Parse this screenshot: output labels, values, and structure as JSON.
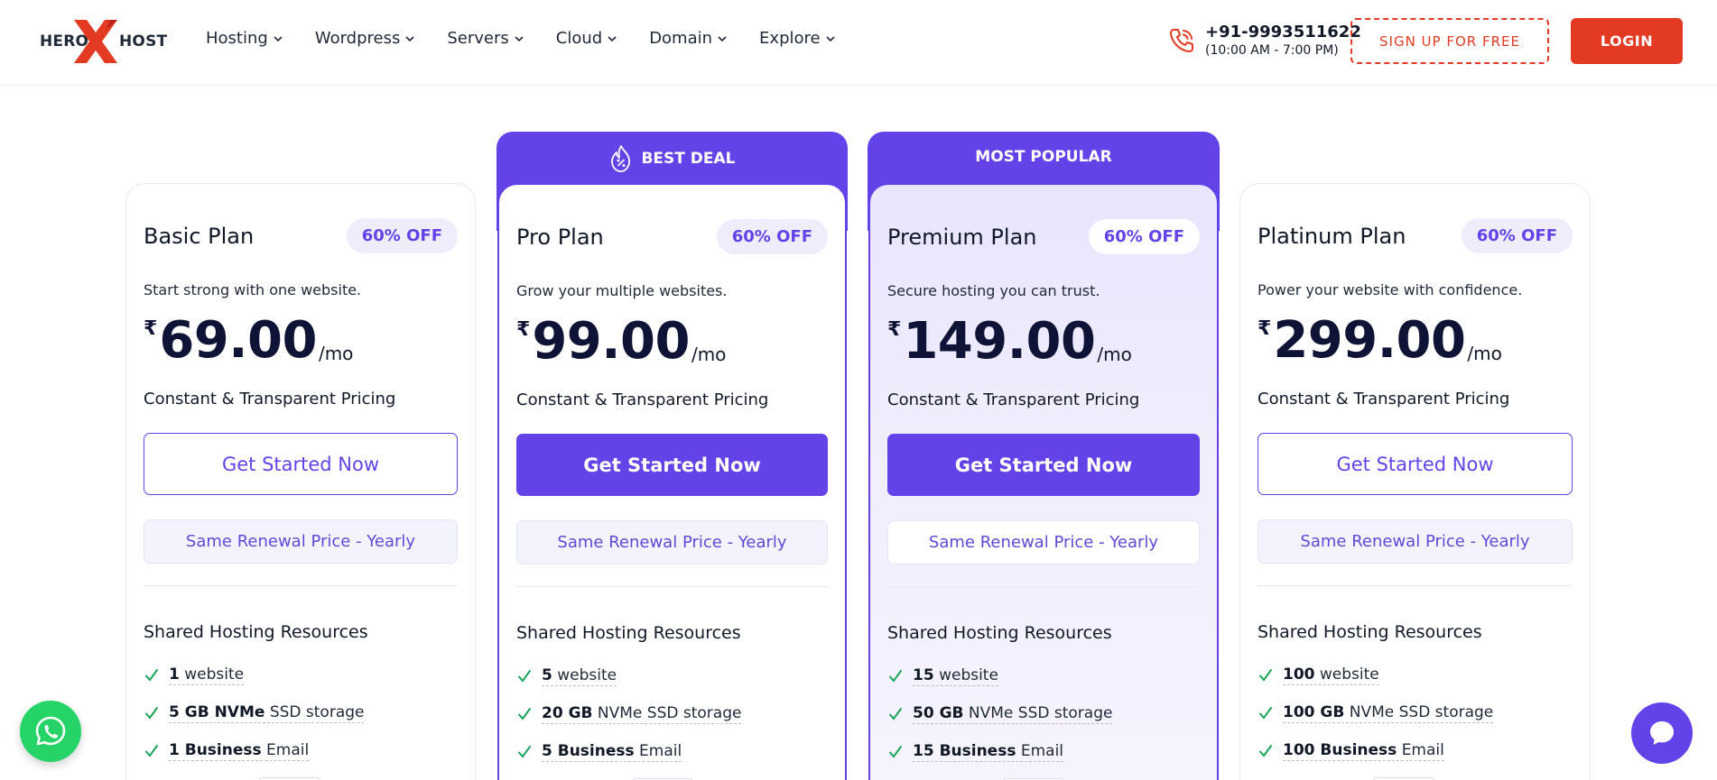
{
  "brand": {
    "logo_left": "HERO",
    "logo_right": "HOST",
    "accent": "#6343e8",
    "red": "#e23a23"
  },
  "nav": {
    "items": [
      {
        "label": "Hosting"
      },
      {
        "label": "Wordpress"
      },
      {
        "label": "Servers"
      },
      {
        "label": "Cloud"
      },
      {
        "label": "Domain"
      },
      {
        "label": "Explore"
      }
    ]
  },
  "contact": {
    "phone": "+91-9993511622",
    "hours": "(10:00 AM - 7:00 PM)"
  },
  "header_buttons": {
    "signup": "SIGN UP FOR FREE",
    "login": "LOGIN"
  },
  "ribbons": {
    "best_deal": "BEST DEAL",
    "most_popular": "MOST POPULAR"
  },
  "plans": [
    {
      "name": "Basic Plan",
      "badge": "60% OFF",
      "tagline": "Start strong with one website.",
      "currency": "₹",
      "price": "69.00",
      "per": "/mo",
      "pricing_note": "Constant & Transparent Pricing",
      "cta": "Get Started Now",
      "renewal": "Same Renewal Price - Yearly",
      "resources_title": "Shared Hosting Resources",
      "features": [
        {
          "bold": "1",
          "rest": "website"
        },
        {
          "bold": "5 GB NVMe",
          "rest": "SSD storage"
        },
        {
          "bold": "1 Business",
          "rest": "Email"
        }
      ]
    },
    {
      "name": "Pro Plan",
      "badge": "60% OFF",
      "tagline": "Grow your multiple websites.",
      "currency": "₹",
      "price": "99.00",
      "per": "/mo",
      "pricing_note": "Constant & Transparent Pricing",
      "cta": "Get Started Now",
      "renewal": "Same Renewal Price - Yearly",
      "resources_title": "Shared Hosting Resources",
      "features": [
        {
          "bold": "5",
          "rest": "website"
        },
        {
          "bold": "20 GB",
          "rest": "NVMe SSD storage"
        },
        {
          "bold": "5 Business",
          "rest": "Email"
        }
      ]
    },
    {
      "name": "Premium Plan",
      "badge": "60% OFF",
      "tagline": "Secure hosting you can trust.",
      "currency": "₹",
      "price": "149.00",
      "per": "/mo",
      "pricing_note": "Constant & Transparent Pricing",
      "cta": "Get Started Now",
      "renewal": "Same Renewal Price - Yearly",
      "resources_title": "Shared Hosting Resources",
      "features": [
        {
          "bold": "15",
          "rest": "website"
        },
        {
          "bold": "50 GB",
          "rest": "NVMe SSD storage"
        },
        {
          "bold": "15 Business",
          "rest": "Email"
        }
      ]
    },
    {
      "name": "Platinum Plan",
      "badge": "60% OFF",
      "tagline": "Power your website with confidence.",
      "currency": "₹",
      "price": "299.00",
      "per": "/mo",
      "pricing_note": "Constant & Transparent Pricing",
      "cta": "Get Started Now",
      "renewal": "Same Renewal Price - Yearly",
      "resources_title": "Shared Hosting Resources",
      "features": [
        {
          "bold": "100",
          "rest": "website"
        },
        {
          "bold": "100 GB",
          "rest": "NVMe SSD storage"
        },
        {
          "bold": "100 Business",
          "rest": "Email"
        }
      ]
    }
  ],
  "floating": {
    "whatsapp_icon": "whatsapp-icon",
    "chat_icon": "chat-bubble-icon"
  }
}
